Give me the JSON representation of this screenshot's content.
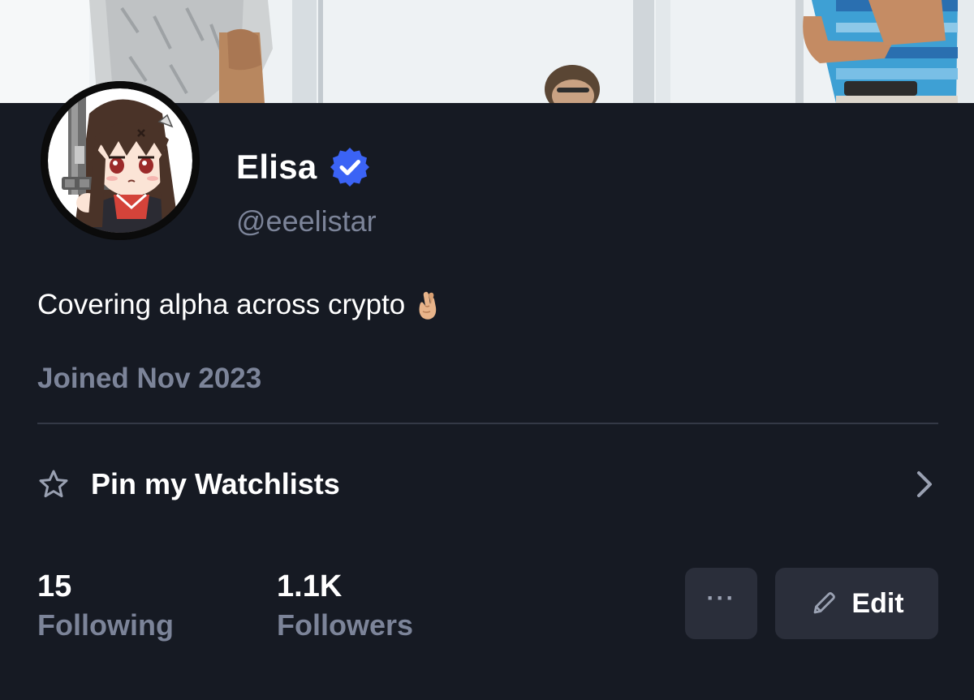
{
  "profile": {
    "display_name": "Elisa",
    "handle": "@eeelistar",
    "bio": "Covering alpha across crypto",
    "bio_emoji": "fingers-crossed-emoji",
    "joined": "Joined Nov 2023",
    "verified": true
  },
  "watchlist": {
    "label": "Pin my Watchlists",
    "icon": "star-icon"
  },
  "stats": {
    "following": {
      "value": "15",
      "label": "Following"
    },
    "followers": {
      "value": "1.1K",
      "label": "Followers"
    }
  },
  "actions": {
    "more_label": "···",
    "edit_label": "Edit",
    "edit_icon": "pencil-icon"
  },
  "colors": {
    "background": "#161a23",
    "muted_text": "#7c8499",
    "verified_badge": "#3b63f5",
    "button_bg": "#2a2e3a",
    "divider": "#343946"
  }
}
